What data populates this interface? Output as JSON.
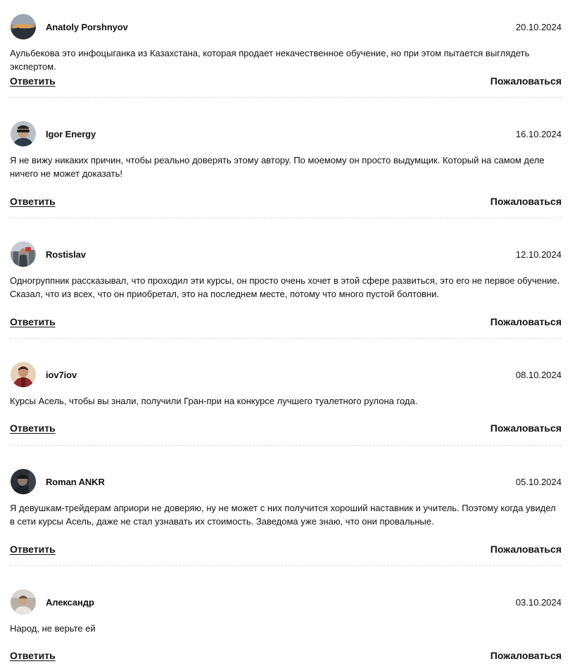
{
  "actions": {
    "reply_label": "Ответить",
    "report_label": "Пожаловаться"
  },
  "comments": [
    {
      "author": "Anatoly Porshnyov",
      "date": "20.10.2024",
      "text": "Аульбекова это инфоцыганка из Казахстана, которая продает некачественное обучение, но при этом пытается выглядеть экспертом."
    },
    {
      "author": "Igor Energy",
      "date": "16.10.2024",
      "text": "Я не вижу никаких причин, чтобы реально доверять этому автору. По моемому он просто выдумщик. Который на самом деле ничего не может доказать!"
    },
    {
      "author": "Rostislav",
      "date": "12.10.2024",
      "text": "Одногруппник рассказывал, что проходил эти курсы, он просто очень хочет в этой сфере развиться, это его не первое обучение. Сказал, что из всех, что он приобретал, это на последнем месте, потому что много пустой болтовни."
    },
    {
      "author": "iov7iov",
      "date": "08.10.2024",
      "text": "Курсы Асель, чтобы вы знали, получили Гран-при на конкурсе лучшего туалетного рулона года."
    },
    {
      "author": "Roman ANKR",
      "date": "05.10.2024",
      "text": "Я девушкам-трейдерам априори не доверяю, ну не может с них получится хороший наставник и учитель. Поэтому когда увидел в сети курсы Асель, даже не стал узнавать их стоимость. Заведома уже знаю, что они провальные."
    },
    {
      "author": "Александр",
      "date": "03.10.2024",
      "text": "Народ, не верьте ей"
    }
  ]
}
